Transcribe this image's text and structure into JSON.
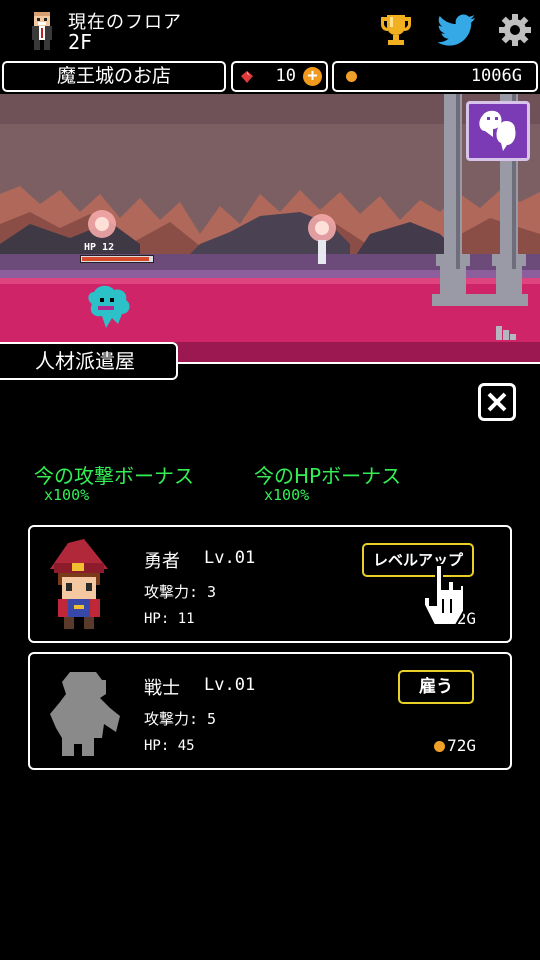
{
  "header": {
    "floor_label": "現在のフロア",
    "floor_value": "2F"
  },
  "info": {
    "shop_name": "魔王城のお店",
    "gems": "10",
    "gold": "1006G"
  },
  "battle": {
    "enemy_hp_label": "HP 12",
    "enemy_hp_fraction": 0.95
  },
  "panel": {
    "tab_label": "人材派遣屋",
    "attack_bonus_label": "今の攻撃ボーナス",
    "attack_bonus_value": "x100%",
    "hp_bonus_label": "今のHPボーナス",
    "hp_bonus_value": "x100%"
  },
  "units": [
    {
      "name": "勇者",
      "level": "Lv.01",
      "attack": "攻撃力: 3",
      "hp": "HP: 11",
      "button": "レベルアップ",
      "price": "52G"
    },
    {
      "name": "戦士",
      "level": "Lv.01",
      "attack": "攻撃力: 5",
      "hp": "HP: 45",
      "button": "雇う",
      "price": "72G"
    }
  ],
  "colors": {
    "bonus_text": "#33ee55",
    "button_border": "#e8d028",
    "coin": "#f0a028",
    "floor_magenta": "#d0246a"
  }
}
